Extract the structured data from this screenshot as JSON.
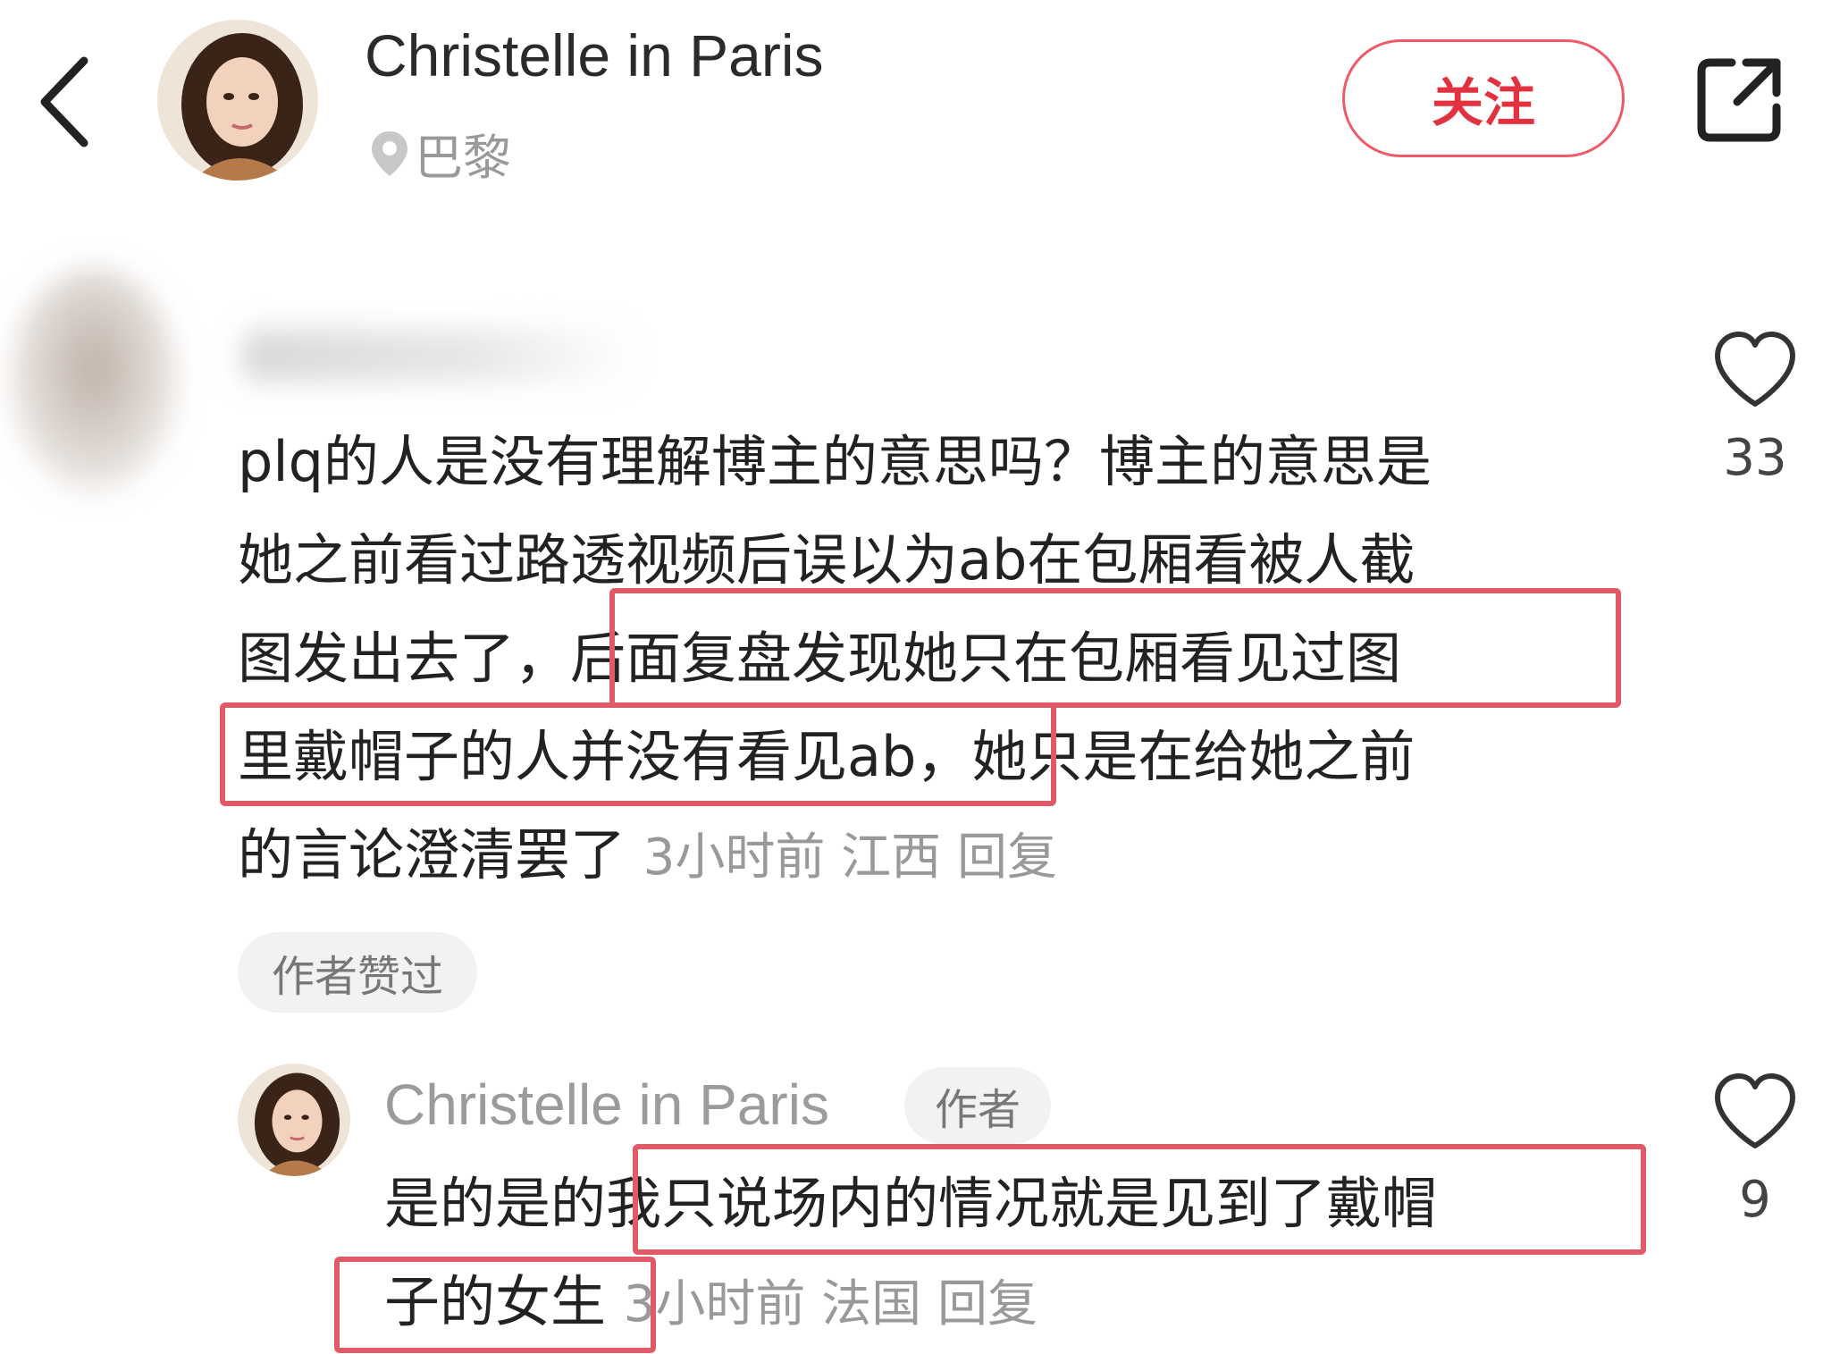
{
  "header": {
    "title": "Christelle in Paris",
    "location": "巴黎",
    "follow_label": "关注"
  },
  "comment": {
    "lines": [
      "plq的人是没有理解博主的意思吗？博主的意思是",
      "她之前看过路透视频后误以为ab在包厢看被人截",
      "图发出去了，后面复盘发现她只在包厢看见过图",
      "里戴帽子的人并没有看见ab，她只是在给她之前",
      "的言论澄清罢了"
    ],
    "meta": "3小时前 江西 回复",
    "liked_badge": "作者赞过",
    "like_count": "33"
  },
  "reply": {
    "name": "Christelle in Paris",
    "author_badge": "作者",
    "lines": [
      "是的是的我只说场内的情况就是见到了戴帽",
      "子的女生"
    ],
    "meta": "3小时前 法国 回复",
    "like_count": "9"
  },
  "colors": {
    "accent": "#e3323f",
    "highlight_box": "#e05a68",
    "meta_text": "#999999"
  },
  "icons": [
    "back-icon",
    "location-pin-icon",
    "share-icon",
    "heart-icon"
  ]
}
